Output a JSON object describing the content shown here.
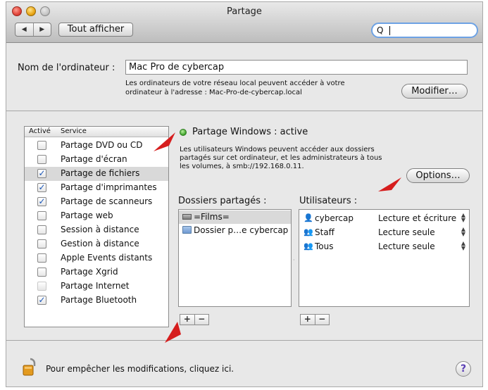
{
  "window": {
    "title": "Partage"
  },
  "toolbar": {
    "back": "◀",
    "forward": "▶",
    "show_all": "Tout afficher",
    "search_icon": "search-icon",
    "search_glyph": "Q",
    "search_value": ""
  },
  "computer": {
    "label": "Nom de l'ordinateur :",
    "name": "Mac Pro de cybercap",
    "info_line1": "Les ordinateurs de votre réseau local peuvent accéder à votre",
    "info_line2": "ordinateur à l'adresse : Mac-Pro-de-cybercap.local",
    "modify_button": "Modifier…"
  },
  "services": {
    "col_active": "Activé",
    "col_service": "Service",
    "items": [
      {
        "label": "Partage DVD ou CD",
        "checked": false,
        "selected": false
      },
      {
        "label": "Partage d'écran",
        "checked": false,
        "selected": false
      },
      {
        "label": "Partage de fichiers",
        "checked": true,
        "selected": true
      },
      {
        "label": "Partage d'imprimantes",
        "checked": true,
        "selected": false
      },
      {
        "label": "Partage de scanneurs",
        "checked": true,
        "selected": false
      },
      {
        "label": "Partage web",
        "checked": false,
        "selected": false
      },
      {
        "label": "Session à distance",
        "checked": false,
        "selected": false
      },
      {
        "label": "Gestion à distance",
        "checked": false,
        "selected": false
      },
      {
        "label": "Apple Events distants",
        "checked": false,
        "selected": false
      },
      {
        "label": "Partage Xgrid",
        "checked": false,
        "selected": false
      },
      {
        "label": "Partage Internet",
        "checked": false,
        "selected": false
      },
      {
        "label": "Partage Bluetooth",
        "checked": true,
        "selected": false
      }
    ]
  },
  "status": {
    "title": "Partage Windows : active",
    "color": "#3da02a",
    "desc_line1": "Les utilisateurs Windows peuvent accéder aux dossiers",
    "desc_line2": "partagés sur cet ordinateur, et les administrateurs à tous",
    "desc_line3": "les volumes, à smb://192.168.0.11.",
    "options_button": "Options…"
  },
  "shared_folders": {
    "label": "Dossiers partagés :",
    "items": [
      {
        "name": "=Films=",
        "icon": "drive-icon",
        "selected": true
      },
      {
        "name": "Dossier p…e cybercap",
        "icon": "folder-icon",
        "selected": false
      }
    ]
  },
  "users": {
    "label": "Utilisateurs :",
    "items": [
      {
        "name": "cybercap",
        "icon": "user-icon",
        "permission": "Lecture et écriture"
      },
      {
        "name": "Staff",
        "icon": "group-icon",
        "permission": "Lecture seule"
      },
      {
        "name": "Tous",
        "icon": "everyone-icon",
        "permission": "Lecture seule"
      }
    ]
  },
  "controls": {
    "add": "+",
    "remove": "−",
    "stepper": "▲▼"
  },
  "footer": {
    "lock_text": "Pour empêcher les modifications, cliquez ici.",
    "help": "?"
  },
  "colors": {
    "accent": "#6da2e4",
    "check": "#1b57b8",
    "annotation_arrow": "#d61e1e"
  }
}
